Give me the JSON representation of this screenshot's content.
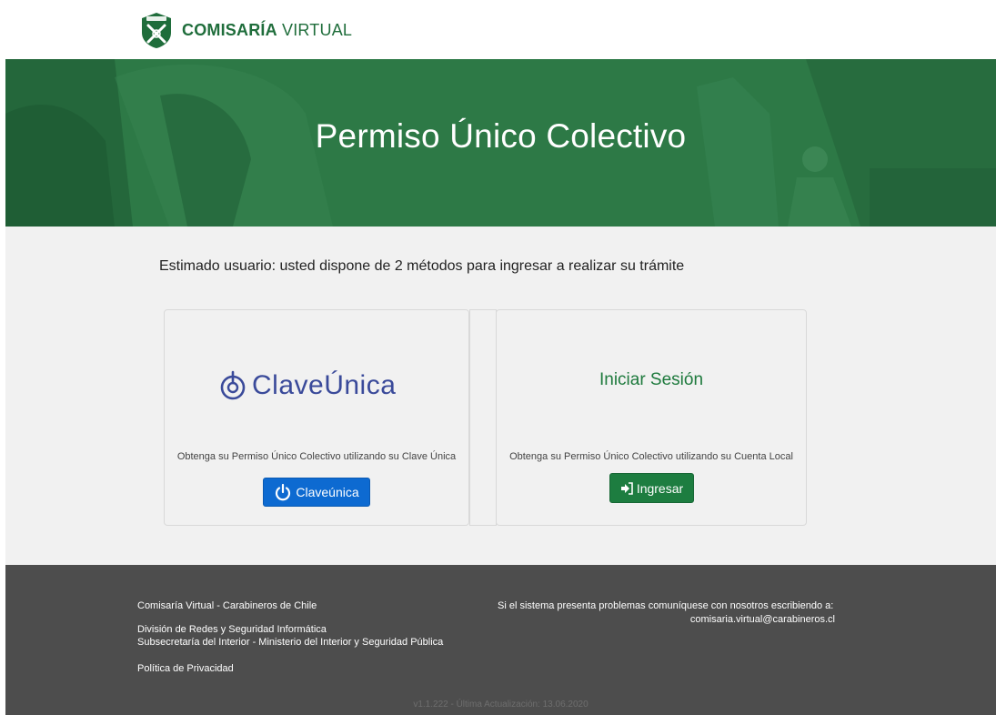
{
  "header": {
    "brand_bold": "COMISARÍA",
    "brand_light": " VIRTUAL"
  },
  "hero": {
    "title": "Permiso Único Colectivo"
  },
  "main": {
    "intro": "Estimado usuario: usted dispone de 2 métodos para ingresar a realizar su trámite",
    "clave_unica_card": {
      "logo_text": "ClaveÚnica",
      "description": "Obtenga su Permiso Único Colectivo utilizando su Clave Única",
      "button_label": "Claveúnica"
    },
    "local_card": {
      "title": "Iniciar Sesión",
      "description": "Obtenga su Permiso Único Colectivo utilizando su Cuenta Local",
      "button_label": "Ingresar"
    }
  },
  "footer": {
    "org_name": "Comisaría Virtual - Carabineros de Chile",
    "division": "División de Redes y Seguridad Informática",
    "subsecretaria": "Subsecretaría del Interior - Ministerio del Interior y Seguridad Pública",
    "privacy": "Política de Privacidad",
    "contact_text": "Si el sistema presenta problemas comuníquese con nosotros escribiendo a:",
    "contact_email": "comisaria.virtual@carabineros.cl",
    "version": "v1.1.222 - Última Actualización: 13.06.2020"
  },
  "colors": {
    "brand_green": "#1f6d3b",
    "hero_green": "#2a7543",
    "clave_unica_blue": "#0d6ad1",
    "login_green": "#1d7d40",
    "footer_bg": "#4d4d4d"
  }
}
